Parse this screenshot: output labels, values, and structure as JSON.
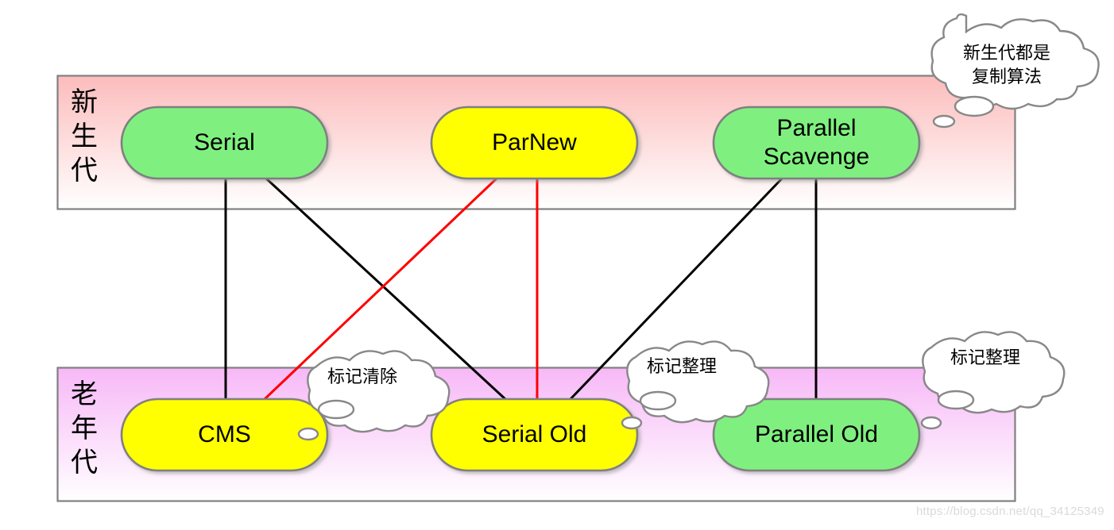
{
  "diagram": {
    "title_watermark": "https://blog.csdn.net/qq_34125349",
    "generations": [
      {
        "id": "young",
        "label": "新\n生\n代",
        "fill_top": "#fcbcbc",
        "fill_bottom": "#ffffff",
        "border": "#808080"
      },
      {
        "id": "old",
        "label": "老\n年\n代",
        "fill_top": "#f7b8f7",
        "fill_bottom": "#ffffff",
        "border": "#808080"
      }
    ],
    "collectors": [
      {
        "id": "serial",
        "label": "Serial",
        "generation": "young",
        "color": "#7ff07f"
      },
      {
        "id": "parnew",
        "label": "ParNew",
        "generation": "young",
        "color": "#ffff00"
      },
      {
        "id": "parallel-scavenge",
        "label": "Parallel\nScavenge",
        "generation": "young",
        "color": "#7ff07f"
      },
      {
        "id": "cms",
        "label": "CMS",
        "generation": "old",
        "color": "#ffff00"
      },
      {
        "id": "serial-old",
        "label": "Serial Old",
        "generation": "old",
        "color": "#ffff00"
      },
      {
        "id": "parallel-old",
        "label": "Parallel Old",
        "generation": "old",
        "color": "#7ff07f"
      }
    ],
    "connections": [
      {
        "from": "serial",
        "to": "cms",
        "color": "#000000"
      },
      {
        "from": "serial",
        "to": "serial-old",
        "color": "#000000"
      },
      {
        "from": "parnew",
        "to": "cms",
        "color": "#ff0000"
      },
      {
        "from": "parnew",
        "to": "serial-old",
        "color": "#ff0000"
      },
      {
        "from": "parallel-scavenge",
        "to": "serial-old",
        "color": "#000000"
      },
      {
        "from": "parallel-scavenge",
        "to": "parallel-old",
        "color": "#000000"
      }
    ],
    "callouts": [
      {
        "id": "young-algorithm",
        "text": "新生代都是\n复制算法",
        "target": "young-generation"
      },
      {
        "id": "cms-algorithm",
        "text": "标记清除",
        "target": "cms"
      },
      {
        "id": "serial-old-algorithm",
        "text": "标记整理",
        "target": "serial-old"
      },
      {
        "id": "parallel-old-algorithm",
        "text": "标记整理",
        "target": "parallel-old"
      }
    ],
    "line_colors": {
      "black": "#000000",
      "red": "#ff0000"
    },
    "cloud_style": {
      "fill": "#ffffff",
      "stroke": "#888888"
    }
  }
}
